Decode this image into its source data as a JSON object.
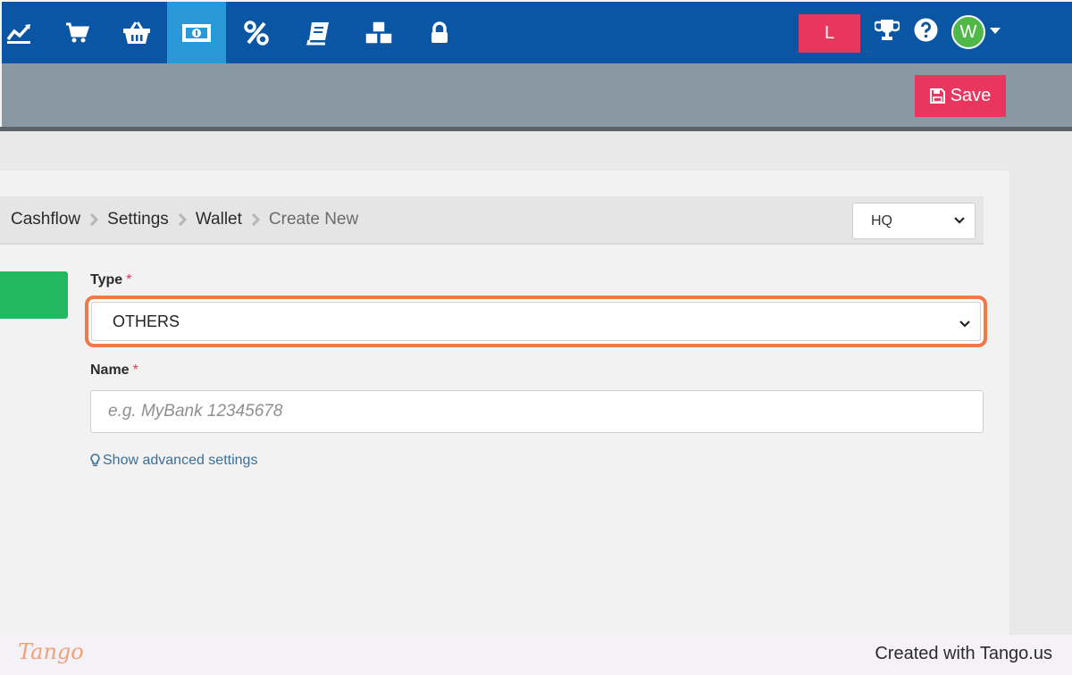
{
  "nav": {
    "icons": [
      "chart-line-icon",
      "cart-icon",
      "basket-icon",
      "money-icon",
      "percent-icon",
      "book-icon",
      "boxes-icon",
      "lock-icon"
    ],
    "active_index": 3,
    "user_badge": "L",
    "avatar_letter": "W",
    "colors": {
      "nav_bg": "#0a56a4",
      "active_bg": "#2a97d8",
      "accent": "#e8365f",
      "avatar_bg": "#50b848"
    }
  },
  "toolbar": {
    "save_label": "Save"
  },
  "breadcrumb": {
    "items": [
      "Cashflow",
      "Settings",
      "Wallet",
      "Create New"
    ]
  },
  "branch_select": {
    "value": "HQ"
  },
  "form": {
    "type_label": "Type",
    "type_value": "OTHERS",
    "name_label": "Name",
    "name_placeholder": "e.g. MyBank 12345678",
    "required_mark": "*",
    "advanced_link": "Show advanced settings"
  },
  "footer": {
    "logo": "Tango",
    "credit": "Created with Tango.us"
  }
}
